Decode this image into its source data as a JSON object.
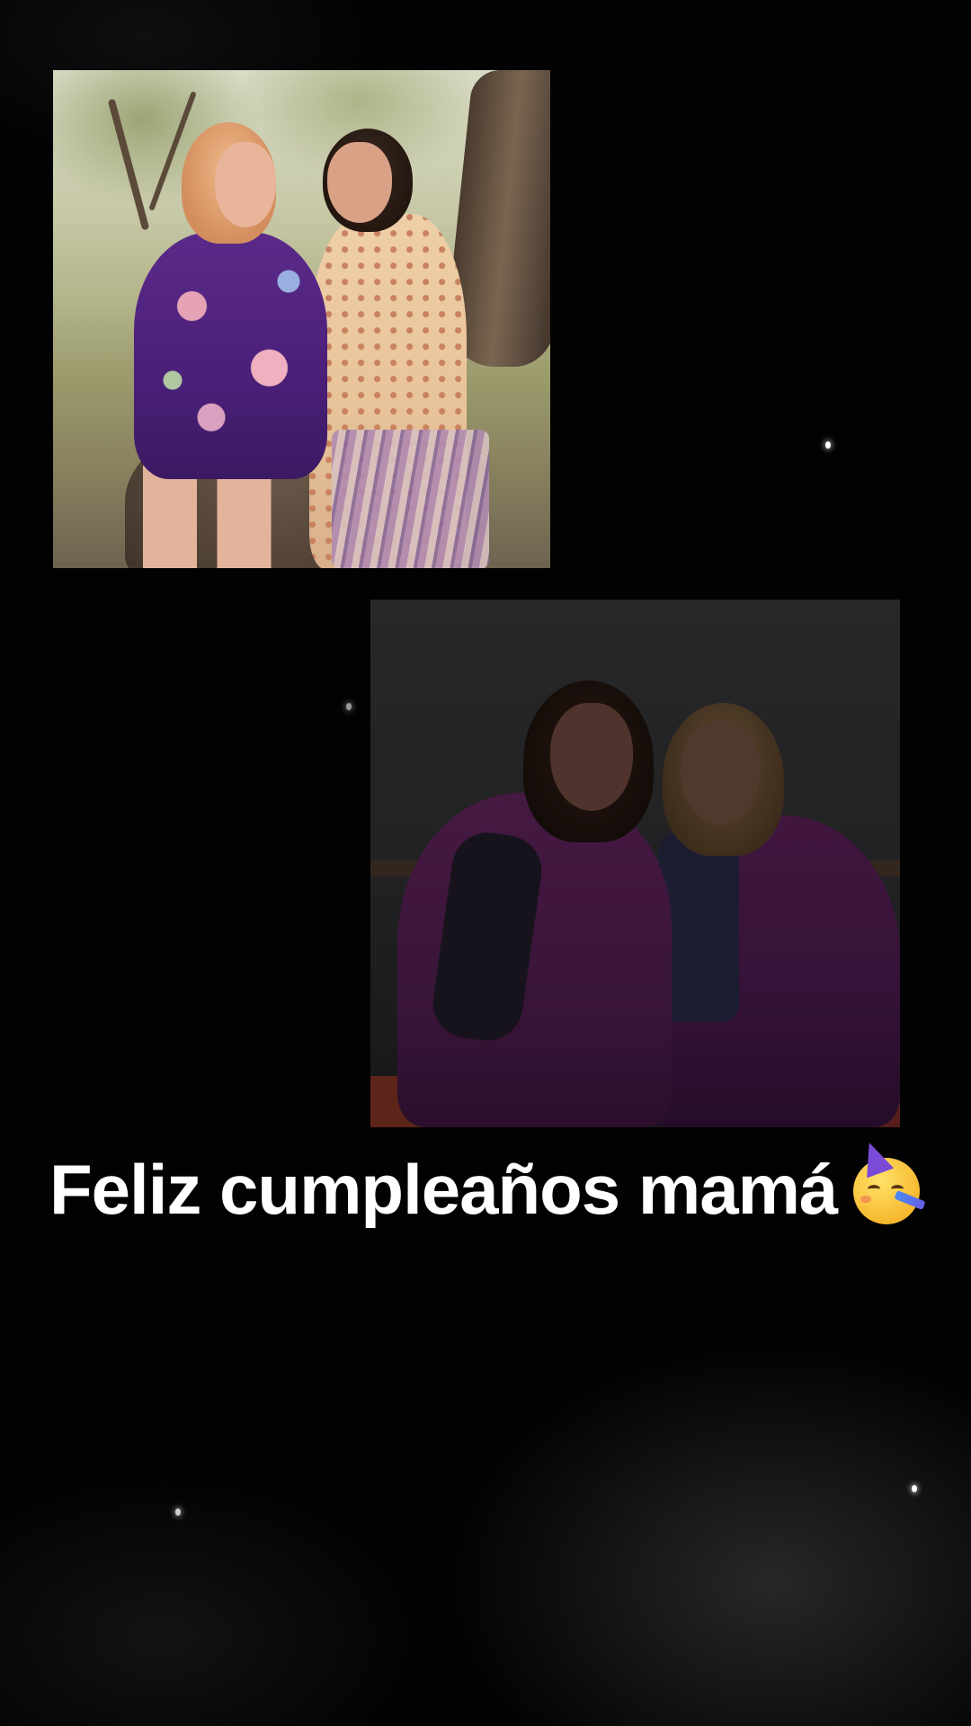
{
  "story": {
    "caption": "Feliz cumpleaños mamá",
    "caption_emoji": "partying-face-emoji"
  },
  "photos": [
    {
      "name": "photo-outdoor",
      "description_icon": "photo-image"
    },
    {
      "name": "photo-indoor",
      "description_icon": "photo-image"
    }
  ],
  "colors": {
    "background": "#020202",
    "caption_text": "#ffffff"
  }
}
